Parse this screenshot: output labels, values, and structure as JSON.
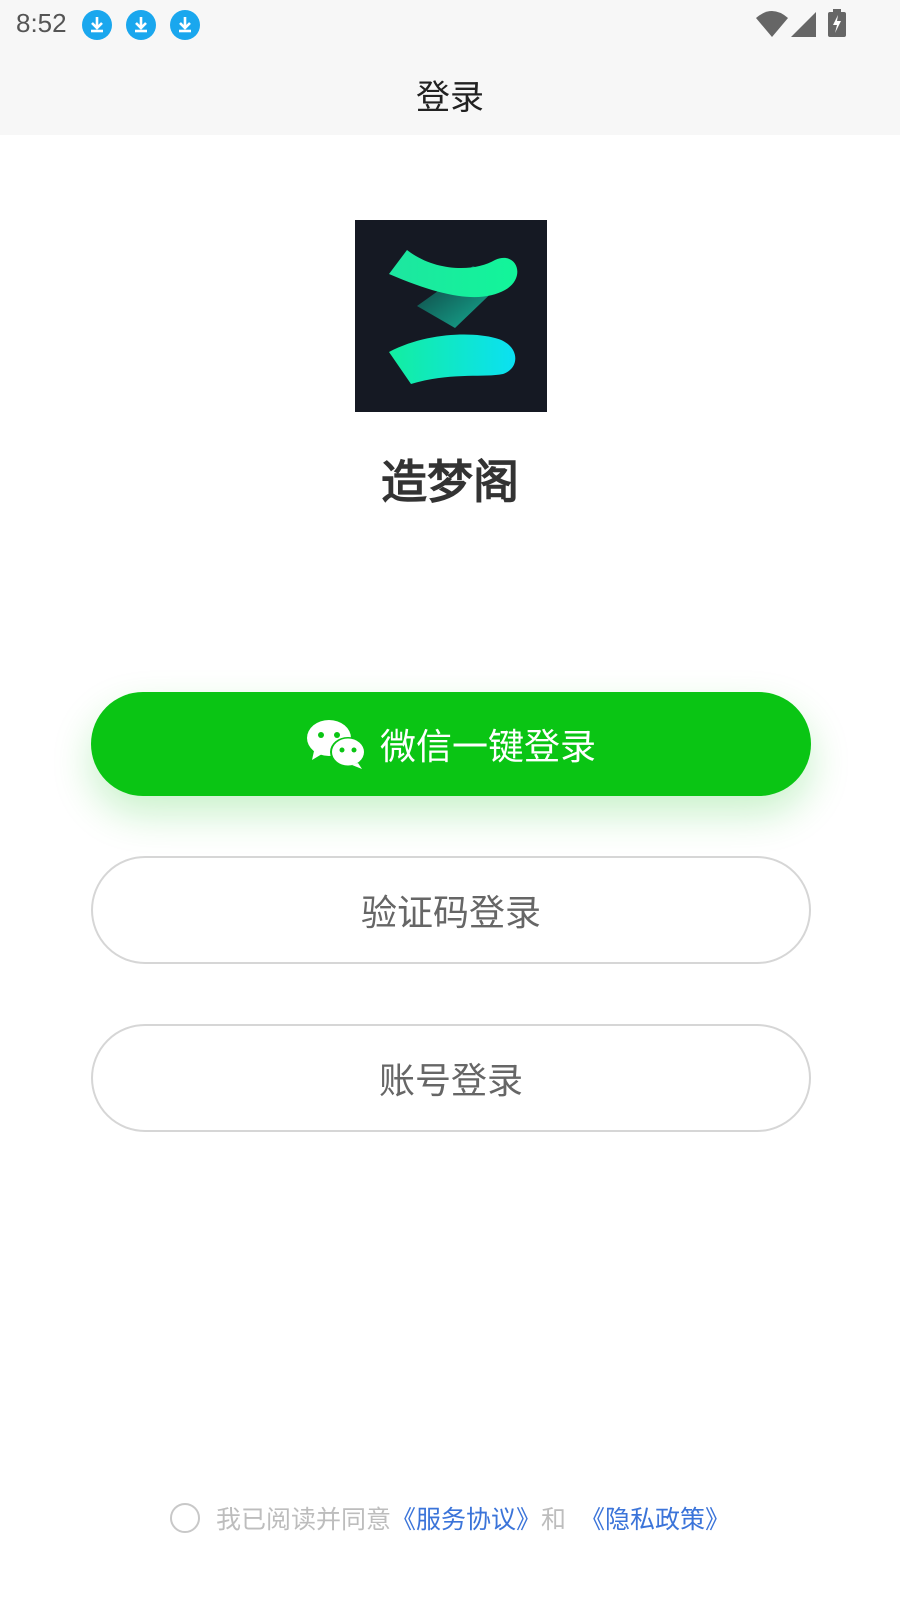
{
  "status_bar": {
    "time": "8:52",
    "notification_icons": [
      "download-icon",
      "download-icon",
      "download-icon"
    ],
    "system_icons": [
      "wifi-icon",
      "signal-icon",
      "battery-charging-icon"
    ]
  },
  "nav": {
    "title": "登录"
  },
  "app": {
    "name": "造梦阁",
    "logo_icon": "z-logo-icon"
  },
  "buttons": {
    "wechat_label": "微信一键登录",
    "code_label": "验证码登录",
    "account_label": "账号登录"
  },
  "agreement": {
    "prefix": "我已阅读并同意",
    "service_link": "《服务协议》",
    "joiner": "和",
    "privacy_link": "《隐私政策》"
  },
  "colors": {
    "wechat_green": "#0AC514",
    "link_blue": "#3B74D9",
    "logo_bg": "#151923"
  }
}
